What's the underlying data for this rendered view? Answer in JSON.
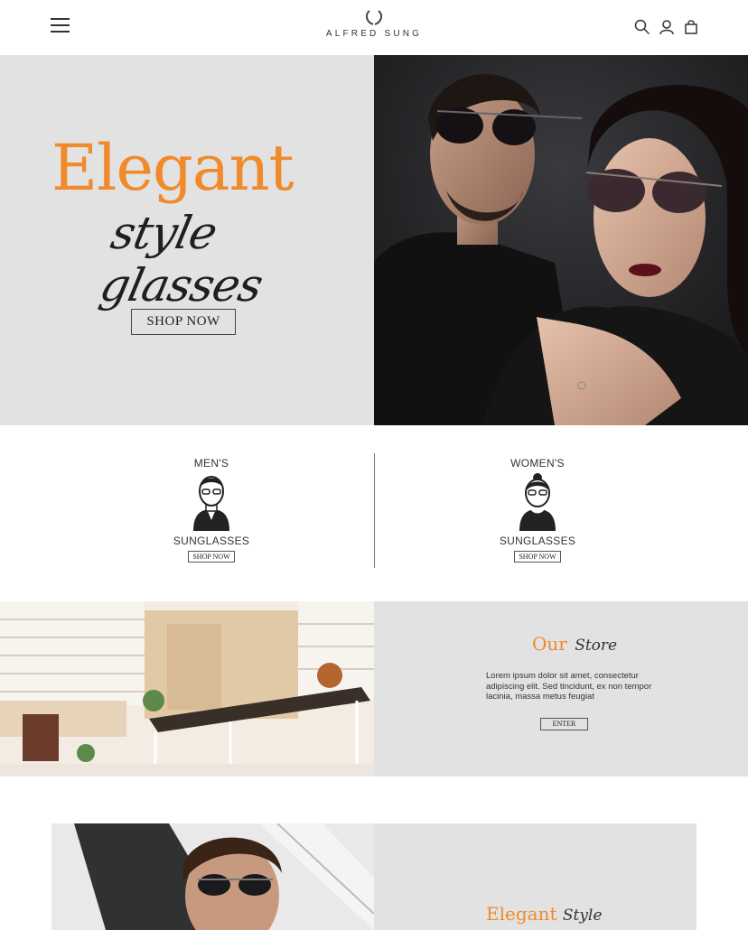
{
  "header": {
    "brand": "ALFRED SUNG",
    "icons": [
      "menu-icon",
      "search-icon",
      "user-icon",
      "cart-icon"
    ]
  },
  "hero": {
    "title": "Elegant",
    "script": "style glasses",
    "button": "SHOP NOW"
  },
  "categories": {
    "men": {
      "top": "MEN'S",
      "bottom": "SUNGLASSES",
      "button": "SHOP NOW"
    },
    "women": {
      "top": "WOMEN'S",
      "bottom": "SUNGLASSES",
      "button": "SHOP NOW"
    }
  },
  "store": {
    "title": "Our",
    "title_script": "Store",
    "text": "Lorem ipsum dolor sit amet, consectetur adipiscing elit. Sed tincidunt, ex non tempor lacinia, massa metus feugiat",
    "button": "ENTER"
  },
  "feature": {
    "title": "Elegant",
    "title_script": "Style"
  },
  "colors": {
    "accent": "#f08a2b",
    "panel": "#e2e2e2",
    "dark": "#1a1a1c"
  }
}
